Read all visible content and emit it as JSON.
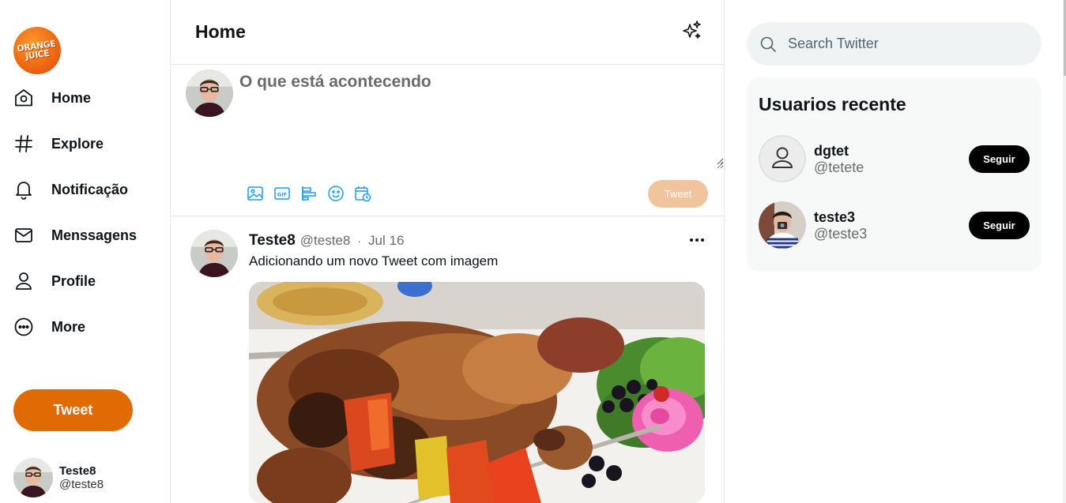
{
  "brand": {
    "logo_text_line1": "ORANGE",
    "logo_text_line2": "JUICE",
    "accent_color": "#e06b04"
  },
  "sidebar": {
    "items": [
      {
        "label": "Home",
        "icon": "home-icon"
      },
      {
        "label": "Explore",
        "icon": "hashtag-icon"
      },
      {
        "label": "Notificação",
        "icon": "bell-icon"
      },
      {
        "label": "Menssagens",
        "icon": "envelope-icon"
      },
      {
        "label": "Profile",
        "icon": "user-icon"
      },
      {
        "label": "More",
        "icon": "more-circle-icon"
      }
    ],
    "tweet_button": "Tweet",
    "profile": {
      "name": "Teste8",
      "handle": "@teste8"
    }
  },
  "main": {
    "title": "Home",
    "compose": {
      "placeholder": "O que está acontecendo",
      "tweet_button": "Tweet",
      "icons": [
        "image-icon",
        "gif-icon",
        "poll-icon",
        "emoji-icon",
        "schedule-icon"
      ]
    },
    "tweet": {
      "name": "Teste8",
      "handle": "@teste8",
      "separator": "·",
      "date": "Jul 16",
      "text": "Adicionando um novo Tweet com imagem"
    }
  },
  "right": {
    "search_placeholder": "Search Twitter",
    "recent_title": "Usuarios recente",
    "users": [
      {
        "name": "dgtet",
        "handle": "@tetete",
        "button": "Seguir"
      },
      {
        "name": "teste3",
        "handle": "@teste3",
        "button": "Seguir"
      }
    ]
  }
}
